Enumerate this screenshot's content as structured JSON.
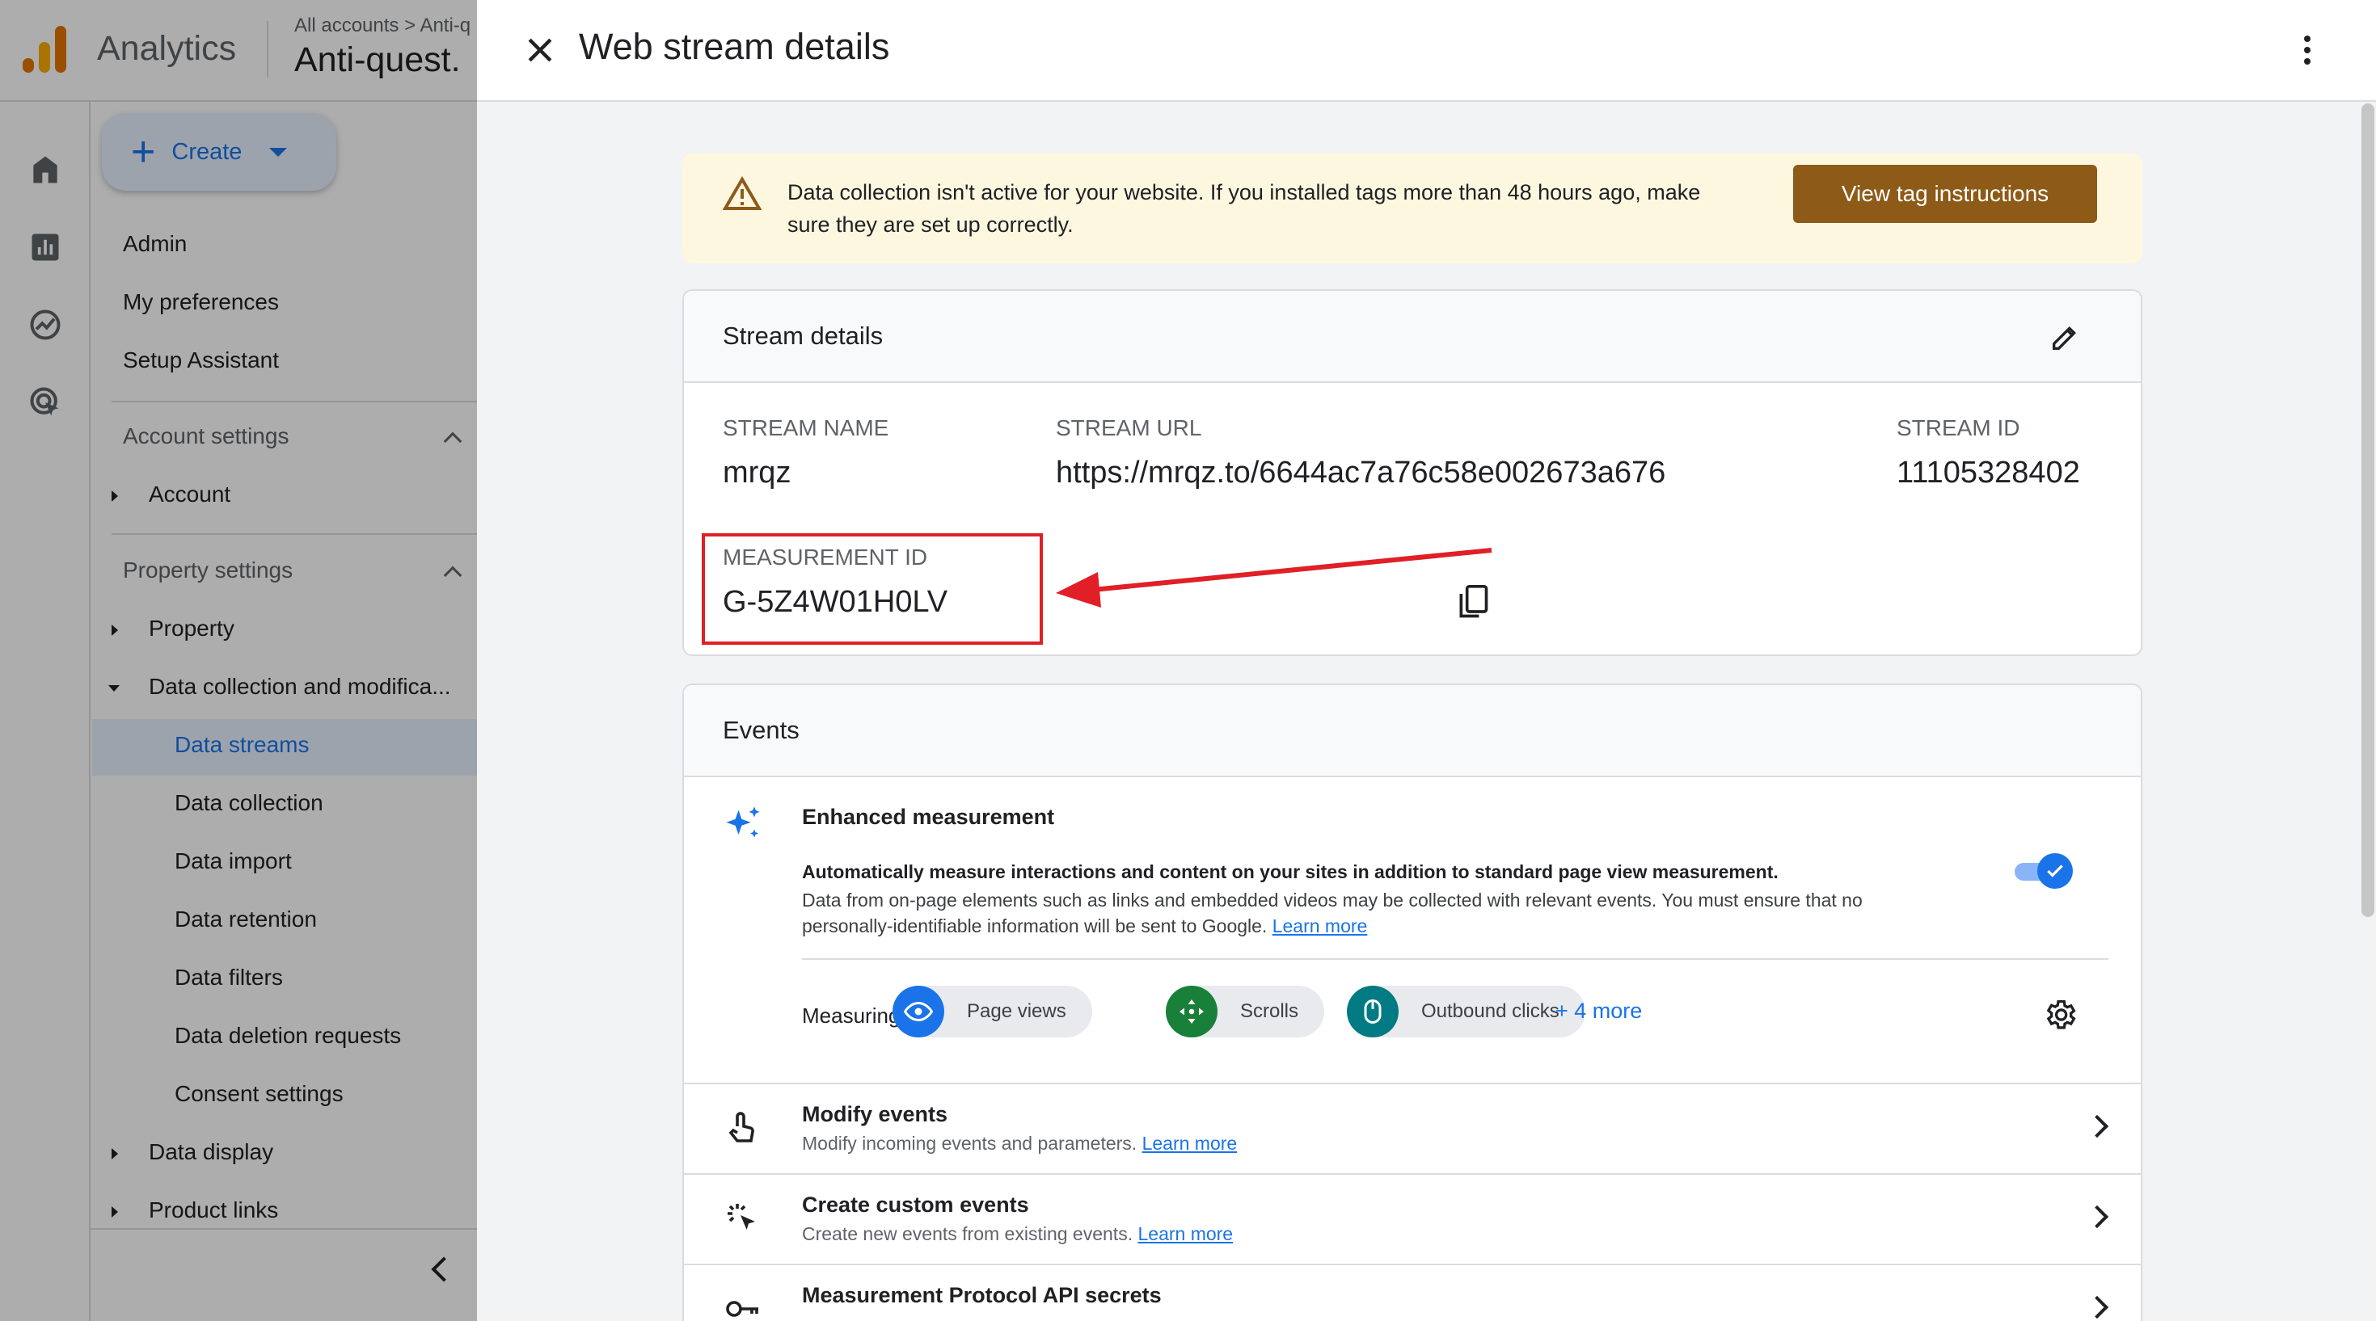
{
  "app": {
    "name": "Analytics",
    "breadcrumb_all": "All accounts",
    "breadcrumb_sep": ">",
    "breadcrumb_account": "Anti-q",
    "account_title": "Anti-quest."
  },
  "nav": {
    "create_label": "Create",
    "items": {
      "admin": "Admin",
      "my_preferences": "My preferences",
      "setup_assistant": "Setup Assistant",
      "account_settings": "Account settings",
      "account": "Account",
      "property_settings": "Property settings",
      "property": "Property",
      "data_collection_mod": "Data collection and modifica...",
      "data_streams": "Data streams",
      "data_collection": "Data collection",
      "data_import": "Data import",
      "data_retention": "Data retention",
      "data_filters": "Data filters",
      "data_deletion": "Data deletion requests",
      "consent_settings": "Consent settings",
      "data_display": "Data display",
      "product_links": "Product links"
    }
  },
  "dialog": {
    "title": "Web stream details",
    "alert": {
      "text": "Data collection isn't active for your website. If you installed tags more than 48 hours ago, make sure they are set up correctly.",
      "button": "View tag instructions"
    },
    "stream_details": {
      "heading": "Stream details",
      "stream_name_label": "STREAM NAME",
      "stream_name": "mrqz",
      "stream_url_label": "STREAM URL",
      "stream_url": "https://mrqz.to/6644ac7a76c58e002673a676",
      "stream_id_label": "STREAM ID",
      "stream_id": "11105328402",
      "measurement_id_label": "MEASUREMENT ID",
      "measurement_id": "G-5Z4W01H0LV"
    },
    "events": {
      "heading": "Events",
      "enhanced_title": "Enhanced measurement",
      "enhanced_desc1": "Automatically measure interactions and content on your sites in addition to standard page view measurement.",
      "enhanced_desc2": "Data from on-page elements such as links and embedded videos may be collected with relevant events. You must ensure that no personally-identifiable information will be sent to Google.",
      "learn_more": "Learn more",
      "toggle_on": true,
      "measuring_label": "Measuring:",
      "chips": [
        "Page views",
        "Scrolls",
        "Outbound clicks"
      ],
      "more": "+ 4 more",
      "rows": [
        {
          "title": "Modify events",
          "subtitle": "Modify incoming events and parameters.",
          "link": "Learn more"
        },
        {
          "title": "Create custom events",
          "subtitle": "Create new events from existing events.",
          "link": "Learn more"
        },
        {
          "title": "Measurement Protocol API secrets",
          "subtitle": "",
          "link": ""
        }
      ]
    }
  },
  "colors": {
    "accent_blue": "#1a73e8",
    "alert_bg": "#fef7e0",
    "alert_button": "#8d5a18",
    "annotation_red": "#e01f27",
    "chip_page_views": "#1a73e8",
    "chip_scrolls": "#188038",
    "chip_outbound": "#007b83"
  }
}
